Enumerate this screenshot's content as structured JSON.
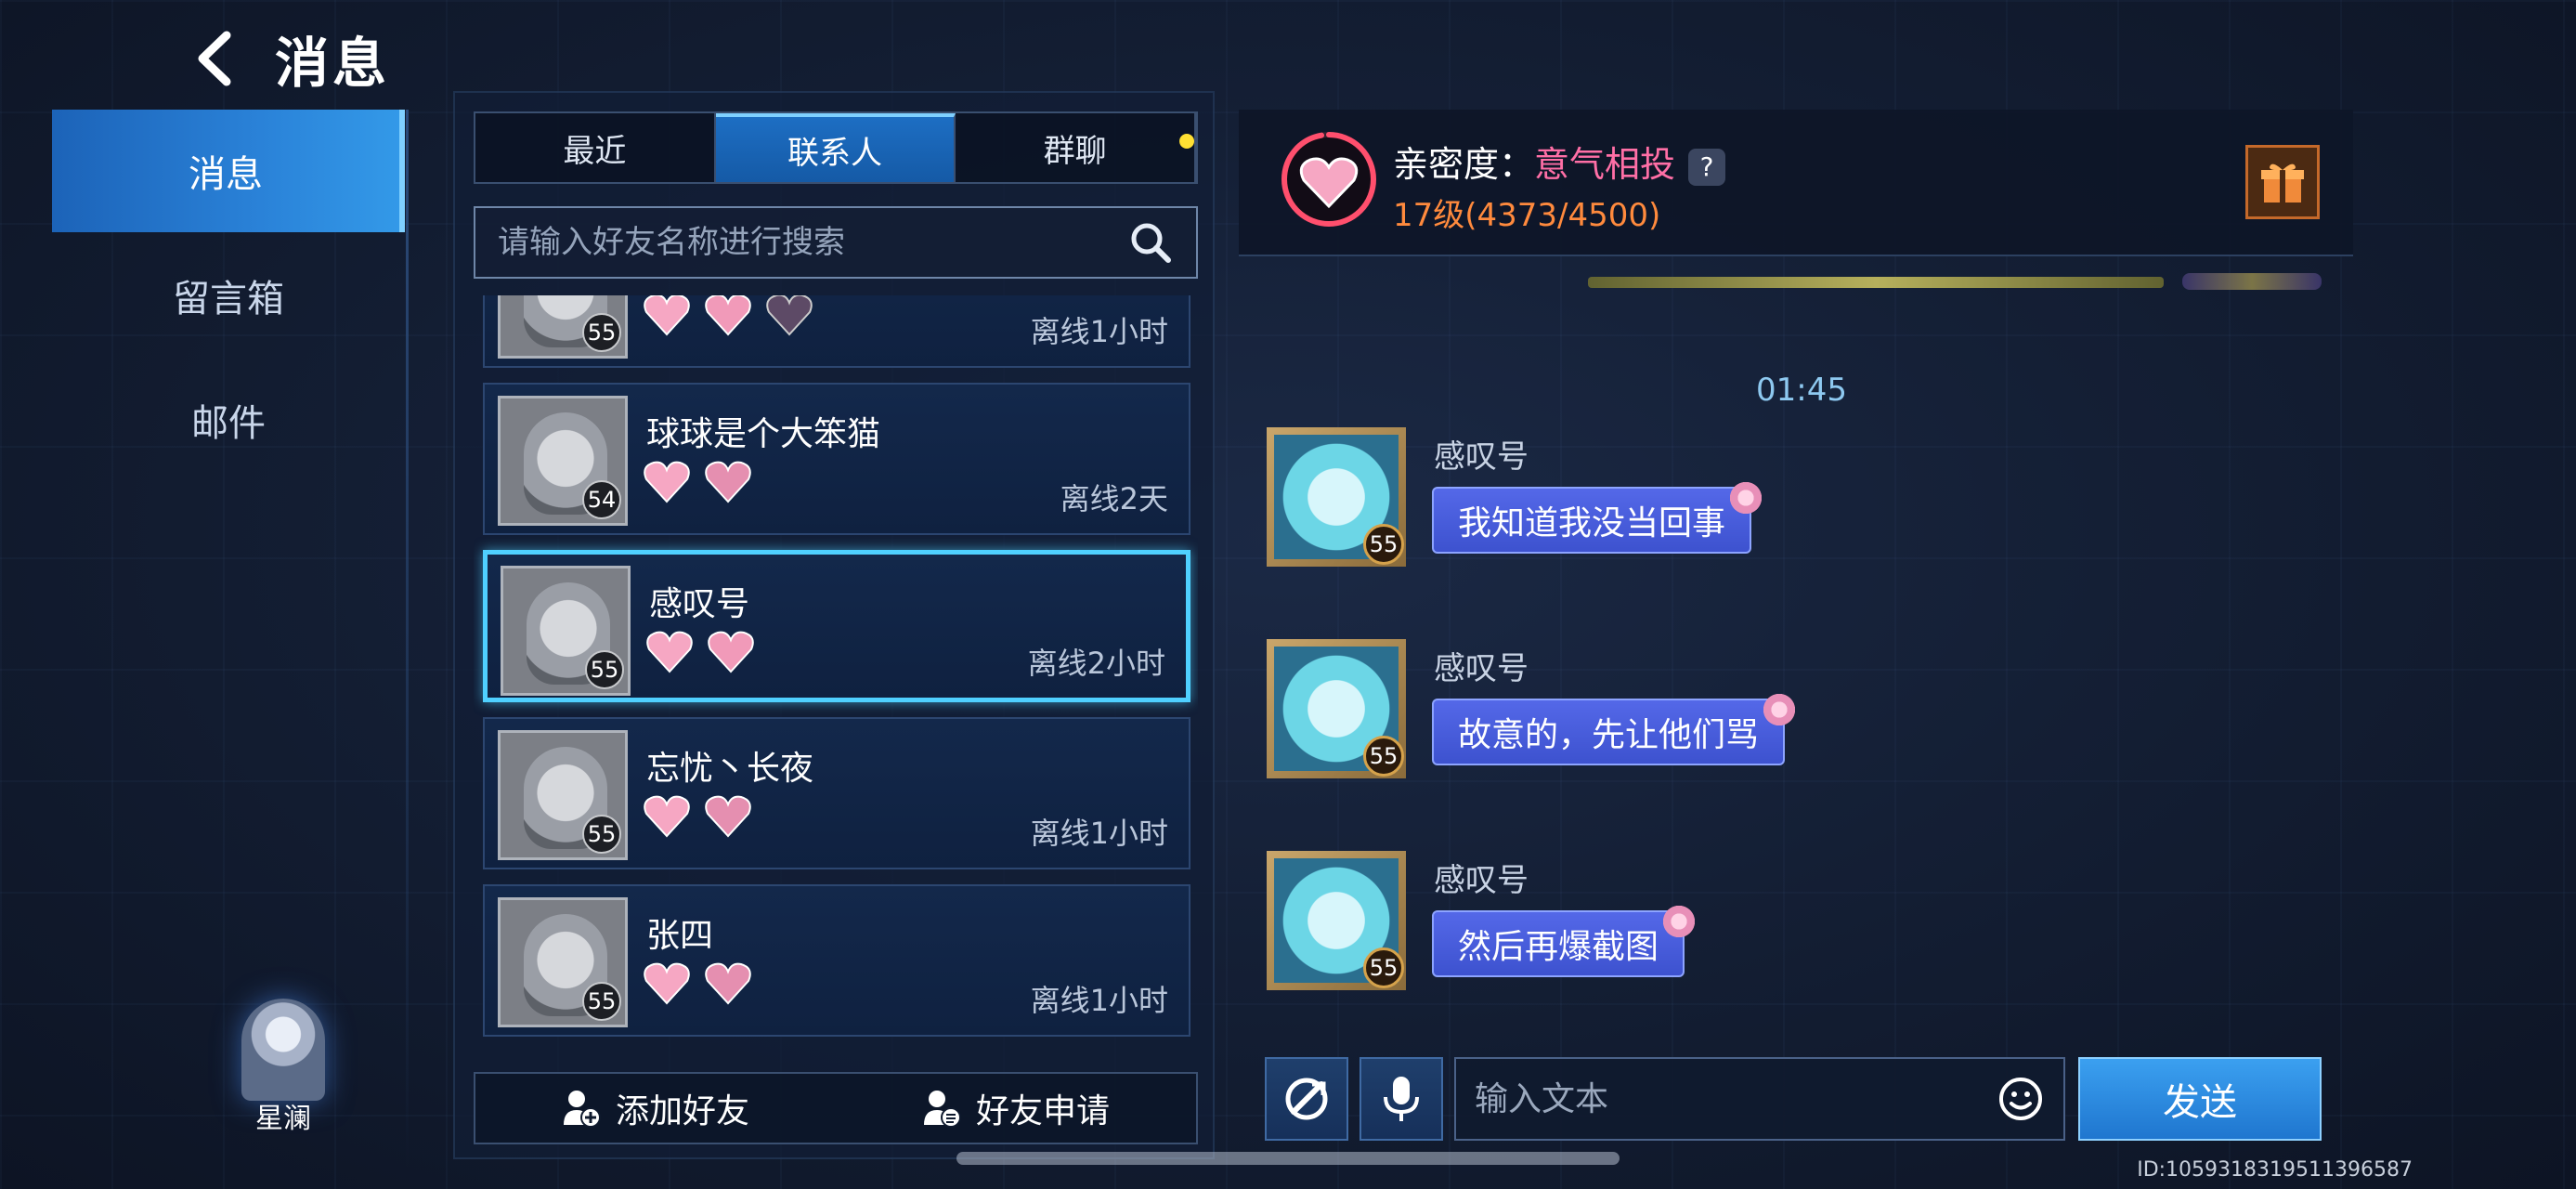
{
  "header": {
    "title": "消息",
    "back_icon": "chevron-left-icon"
  },
  "nav": {
    "items": [
      {
        "label": "消息",
        "active": true
      },
      {
        "label": "留言箱",
        "active": false
      },
      {
        "label": "邮件",
        "active": false
      }
    ]
  },
  "player": {
    "name": "星澜"
  },
  "tabs": [
    {
      "label": "最近",
      "active": false
    },
    {
      "label": "联系人",
      "active": true
    },
    {
      "label": "群聊",
      "active": false
    }
  ],
  "search": {
    "placeholder": "请输入好友名称进行搜索",
    "icon": "search-icon"
  },
  "friends": [
    {
      "name": "",
      "level": "55",
      "hearts": 3,
      "status": "离线1小时"
    },
    {
      "name": "球球是个大笨猫",
      "level": "54",
      "hearts": 2,
      "status": "离线2天"
    },
    {
      "name": "感叹号",
      "level": "55",
      "hearts": 2,
      "status": "离线2小时",
      "selected": true
    },
    {
      "name": "忘忧丶长夜",
      "level": "55",
      "hearts": 2,
      "status": "离线1小时"
    },
    {
      "name": "张四",
      "level": "55",
      "hearts": 2,
      "status": "离线1小时"
    }
  ],
  "bottom_actions": {
    "add_friend": "添加好友",
    "friend_requests": "好友申请"
  },
  "intimacy": {
    "label": "亲密度：",
    "value": "意气相投",
    "help": "?",
    "level_text": "17级(4373/4500)",
    "level_progress": 0.9718
  },
  "chat": {
    "time": "01:45",
    "messages": [
      {
        "sender": "感叹号",
        "level": "55",
        "text": "我知道我没当回事"
      },
      {
        "sender": "感叹号",
        "level": "55",
        "text": "故意的，先让他们骂"
      },
      {
        "sender": "感叹号",
        "level": "55",
        "text": "然后再爆截图"
      }
    ]
  },
  "composer": {
    "placeholder": "输入文本",
    "send_label": "发送"
  },
  "footer": {
    "user_id": "ID:1059318319511396587"
  },
  "colors": {
    "accent": "#2a82d8",
    "selected_border": "#4fd0ff",
    "intimacy_value": "#ff6fa6",
    "level_text": "#ff8a3d"
  }
}
